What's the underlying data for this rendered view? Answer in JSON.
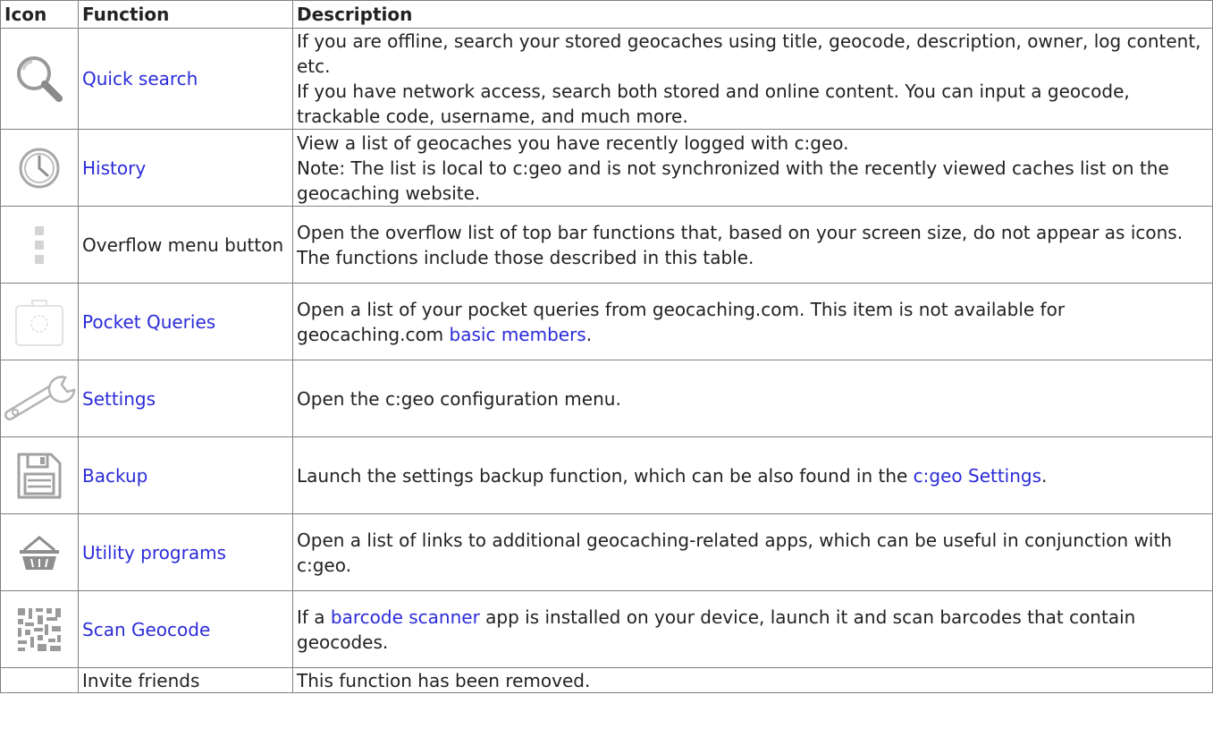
{
  "headers": {
    "icon": "Icon",
    "function": "Function",
    "description": "Description"
  },
  "rows": [
    {
      "icon": "search-magnifier-icon",
      "function": "Quick search",
      "desc": {
        "line1": "If you are offline, search your stored geocaches using title, geocode, description, owner, log content, etc.",
        "line2": "If you have network access, search both stored and online content. You can input a geocode, trackable code, username, and much more."
      }
    },
    {
      "icon": "history-clock-icon",
      "function": "History",
      "desc": {
        "line1": "View a list of geocaches you have recently logged with c:geo.",
        "line2": "Note: The list is local to c:geo and is not synchronized with the recently viewed caches list on the geocaching website."
      }
    },
    {
      "icon": "overflow-menu-icon",
      "function": "Overflow menu button",
      "desc": {
        "text": "Open the overflow list of top bar functions that, based on your screen size, do not appear as icons. The functions include those described in this table."
      }
    },
    {
      "icon": "pocket-queries-icon",
      "function": "Pocket Queries",
      "desc": {
        "before": "Open a list of your pocket queries from geocaching.com. This item is not available for geocaching.com ",
        "link": "basic members",
        "after": "."
      }
    },
    {
      "icon": "wrench-icon",
      "function": "Settings",
      "desc": {
        "text": "Open the c:geo configuration menu."
      }
    },
    {
      "icon": "floppy-disk-icon",
      "function": "Backup",
      "desc": {
        "before": "Launch the settings backup function, which can be also found in the ",
        "link": "c:geo Settings",
        "after": "."
      }
    },
    {
      "icon": "basket-icon",
      "function": "Utility programs",
      "desc": {
        "text": "Open a list of links to additional geocaching-related apps, which can be useful in conjunction with c:geo."
      }
    },
    {
      "icon": "barcode-scan-icon",
      "function": "Scan Geocode",
      "desc": {
        "before": "If a ",
        "link": "barcode scanner",
        "after": " app is installed on your device, launch it and scan barcodes that contain geocodes."
      }
    },
    {
      "icon": "",
      "function": "Invite friends",
      "desc": {
        "text": "This function has been removed."
      }
    }
  ],
  "colors": {
    "link": "#2b2bd9",
    "text": "#222222",
    "border": "#808080",
    "icon_gray": "#9a9a9a"
  }
}
